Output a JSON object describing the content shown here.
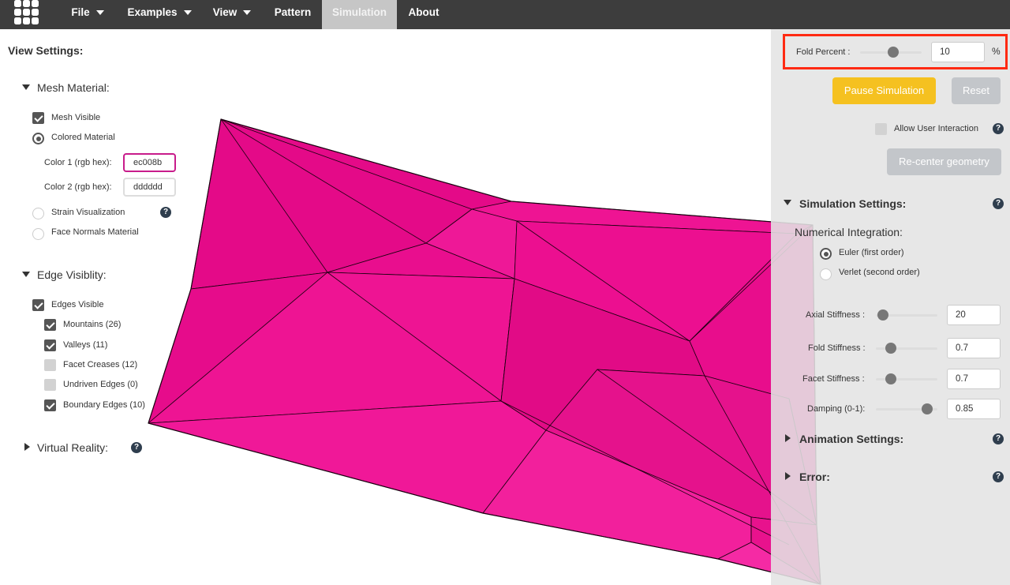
{
  "nav": {
    "menus": [
      {
        "label": "File",
        "caret": true
      },
      {
        "label": "Examples",
        "caret": true
      },
      {
        "label": "View",
        "caret": true
      },
      {
        "label": "Pattern",
        "caret": false
      },
      {
        "label": "Simulation",
        "caret": false,
        "active": true
      },
      {
        "label": "About",
        "caret": false
      }
    ]
  },
  "left": {
    "title": "View Settings:",
    "mesh_material": {
      "heading": "Mesh Material:",
      "mesh_visible": {
        "label": "Mesh Visible",
        "checked": true
      },
      "colored_material": {
        "label": "Colored Material",
        "selected": true
      },
      "color1": {
        "label": "Color 1 (rgb hex):",
        "value": "ec008b"
      },
      "color2": {
        "label": "Color 2 (rgb hex):",
        "value": "dddddd"
      },
      "strain": {
        "label": "Strain Visualization",
        "selected": false
      },
      "normals": {
        "label": "Face Normals Material",
        "selected": false
      }
    },
    "edge_visibility": {
      "heading": "Edge Visiblity:",
      "edges_visible": {
        "label": "Edges Visible",
        "checked": true
      },
      "mountains": {
        "label": "Mountains (26)",
        "checked": true
      },
      "valleys": {
        "label": "Valleys (11)",
        "checked": true
      },
      "facets": {
        "label": "Facet Creases (12)",
        "checked": false
      },
      "undriven": {
        "label": "Undriven Edges (0)",
        "checked": false
      },
      "boundary": {
        "label": "Boundary Edges (10)",
        "checked": true
      }
    },
    "vr": {
      "heading": "Virtual Reality:"
    },
    "help_glyph": "?"
  },
  "right": {
    "fold_percent": {
      "label": "Fold Percent :",
      "value": "10",
      "unit": "%",
      "slider_fraction": 0.5
    },
    "pause_button": "Pause Simulation",
    "reset_button": "Reset",
    "allow_interaction": {
      "label": "Allow User Interaction",
      "checked": false
    },
    "recenter_button": "Re-center geometry",
    "simulation_settings": {
      "heading": "Simulation Settings:",
      "integration_label": "Numerical Integration:",
      "euler": {
        "label": "Euler (first order)",
        "selected": true
      },
      "verlet": {
        "label": "Verlet (second order)",
        "selected": false
      },
      "axial": {
        "label": "Axial Stiffness :",
        "value": "20",
        "slider_fraction": 0.05
      },
      "fold": {
        "label": "Fold Stiffness :",
        "value": "0.7",
        "slider_fraction": 0.15
      },
      "facet": {
        "label": "Facet Stiffness :",
        "value": "0.7",
        "slider_fraction": 0.15
      },
      "damping": {
        "label": "Damping (0-1):",
        "value": "0.85",
        "slider_fraction": 0.85
      }
    },
    "animation_settings": {
      "heading": "Animation Settings:"
    },
    "error": {
      "heading": "Error:"
    }
  },
  "colors": {
    "mesh": "#ec008b",
    "navbar": "#3d3d3d",
    "pause_button": "#f5c120",
    "disabled_button": "#c3c6ca",
    "highlight": "#ff2a12"
  }
}
